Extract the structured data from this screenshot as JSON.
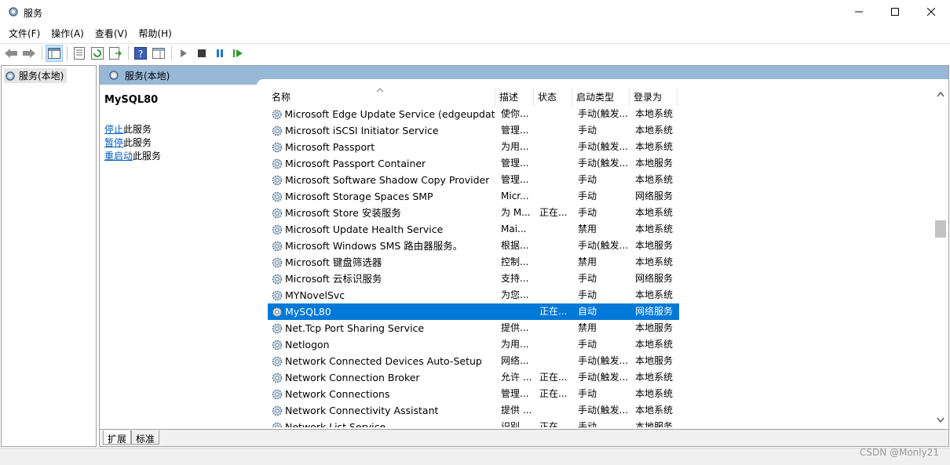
{
  "window": {
    "title": "服务"
  },
  "menu": [
    {
      "label": "文件(F)"
    },
    {
      "label": "操作(A)"
    },
    {
      "label": "查看(V)"
    },
    {
      "label": "帮助(H)"
    }
  ],
  "tree": {
    "root_label": "服务(本地)"
  },
  "header": {
    "title": "服务(本地)"
  },
  "detail": {
    "service_name": "MySQL80",
    "stop_link": "停止",
    "stop_suffix": "此服务",
    "pause_link": "暂停",
    "pause_suffix": "此服务",
    "restart_link": "重启动",
    "restart_suffix": "此服务"
  },
  "columns": {
    "name": "名称",
    "desc": "描述",
    "status": "状态",
    "start": "启动类型",
    "logon": "登录为"
  },
  "rows": [
    {
      "name": "Microsoft Edge Update Service (edgeupdat...",
      "desc": "使你...",
      "status": "",
      "start": "手动(触发...",
      "logon": "本地系统"
    },
    {
      "name": "Microsoft iSCSI Initiator Service",
      "desc": "管理...",
      "status": "",
      "start": "手动",
      "logon": "本地系统"
    },
    {
      "name": "Microsoft Passport",
      "desc": "为用...",
      "status": "",
      "start": "手动(触发...",
      "logon": "本地系统"
    },
    {
      "name": "Microsoft Passport Container",
      "desc": "管理...",
      "status": "",
      "start": "手动(触发...",
      "logon": "本地服务"
    },
    {
      "name": "Microsoft Software Shadow Copy Provider",
      "desc": "管理...",
      "status": "",
      "start": "手动",
      "logon": "本地系统"
    },
    {
      "name": "Microsoft Storage Spaces SMP",
      "desc": "Micr...",
      "status": "",
      "start": "手动",
      "logon": "网络服务"
    },
    {
      "name": "Microsoft Store 安装服务",
      "desc": "为 M...",
      "status": "正在...",
      "start": "手动",
      "logon": "本地系统"
    },
    {
      "name": "Microsoft Update Health Service",
      "desc": "Mai...",
      "status": "",
      "start": "禁用",
      "logon": "本地系统"
    },
    {
      "name": "Microsoft Windows SMS 路由器服务。",
      "desc": "根据...",
      "status": "",
      "start": "手动(触发...",
      "logon": "本地服务"
    },
    {
      "name": "Microsoft 键盘筛选器",
      "desc": "控制...",
      "status": "",
      "start": "禁用",
      "logon": "本地系统"
    },
    {
      "name": "Microsoft 云标识服务",
      "desc": "支持...",
      "status": "",
      "start": "手动",
      "logon": "网络服务"
    },
    {
      "name": "MYNovelSvc",
      "desc": "为您...",
      "status": "",
      "start": "手动",
      "logon": "本地系统"
    },
    {
      "name": "MySQL80",
      "desc": "",
      "status": "正在...",
      "start": "自动",
      "logon": "网络服务",
      "selected": true
    },
    {
      "name": "Net.Tcp Port Sharing Service",
      "desc": "提供...",
      "status": "",
      "start": "禁用",
      "logon": "本地服务"
    },
    {
      "name": "Netlogon",
      "desc": "为用...",
      "status": "",
      "start": "手动",
      "logon": "本地系统"
    },
    {
      "name": "Network Connected Devices Auto-Setup",
      "desc": "网络...",
      "status": "",
      "start": "手动(触发...",
      "logon": "本地服务"
    },
    {
      "name": "Network Connection Broker",
      "desc": "允许 ...",
      "status": "正在...",
      "start": "手动(触发...",
      "logon": "本地系统"
    },
    {
      "name": "Network Connections",
      "desc": "管理...",
      "status": "正在...",
      "start": "手动",
      "logon": "本地系统"
    },
    {
      "name": "Network Connectivity Assistant",
      "desc": "提供 ...",
      "status": "",
      "start": "手动(触发...",
      "logon": "本地系统"
    },
    {
      "name": "Network List Service",
      "desc": "识别...",
      "status": "正在...",
      "start": "手动",
      "logon": "本地服务"
    }
  ],
  "tabs": [
    {
      "label": "扩展"
    },
    {
      "label": "标准"
    }
  ],
  "watermark": "CSDN @Monly21",
  "colors": {
    "selection": "#0078d7",
    "header_band": "#98b8d8",
    "link": "#0060c0"
  },
  "icons": [
    "gear-icon",
    "back-icon",
    "forward-icon",
    "play-icon",
    "stop-icon",
    "pause-icon",
    "restart-icon",
    "help-icon",
    "export-icon",
    "refresh-icon",
    "properties-icon"
  ]
}
